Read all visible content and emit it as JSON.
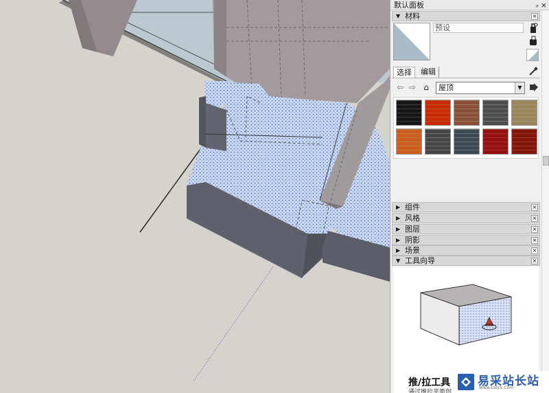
{
  "tray": {
    "title": "默认面板",
    "pin_glyph": "ₚ",
    "close_glyph": "×"
  },
  "materials": {
    "header": "材料",
    "name_placeholder": "预设",
    "tabs": {
      "select": "选择",
      "edit": "编辑"
    },
    "library": "屋顶",
    "swatch_colors": [
      "#4a4a4a",
      "#e4662a",
      "#bb8e76",
      "#8e8c8a",
      "#c6b996",
      "#e49a56",
      "#868686",
      "#7c8a90",
      "#c2413a",
      "#b6482f"
    ]
  },
  "panels": [
    {
      "label": "组件"
    },
    {
      "label": "风格"
    },
    {
      "label": "图层"
    },
    {
      "label": "阴影"
    },
    {
      "label": "场景"
    },
    {
      "label": "工具向导"
    }
  ],
  "guide": {
    "title": "推/拉工具",
    "subtitle": "通过推拉平面创"
  },
  "watermark": {
    "text": "易采站长站",
    "url": "Www.Easck.Com"
  },
  "colors": {
    "selection_blue": "#c9d9f2",
    "selection_dot": "#3a4fa8",
    "ground": "#d6d3cd",
    "wall": "#9a9293"
  }
}
